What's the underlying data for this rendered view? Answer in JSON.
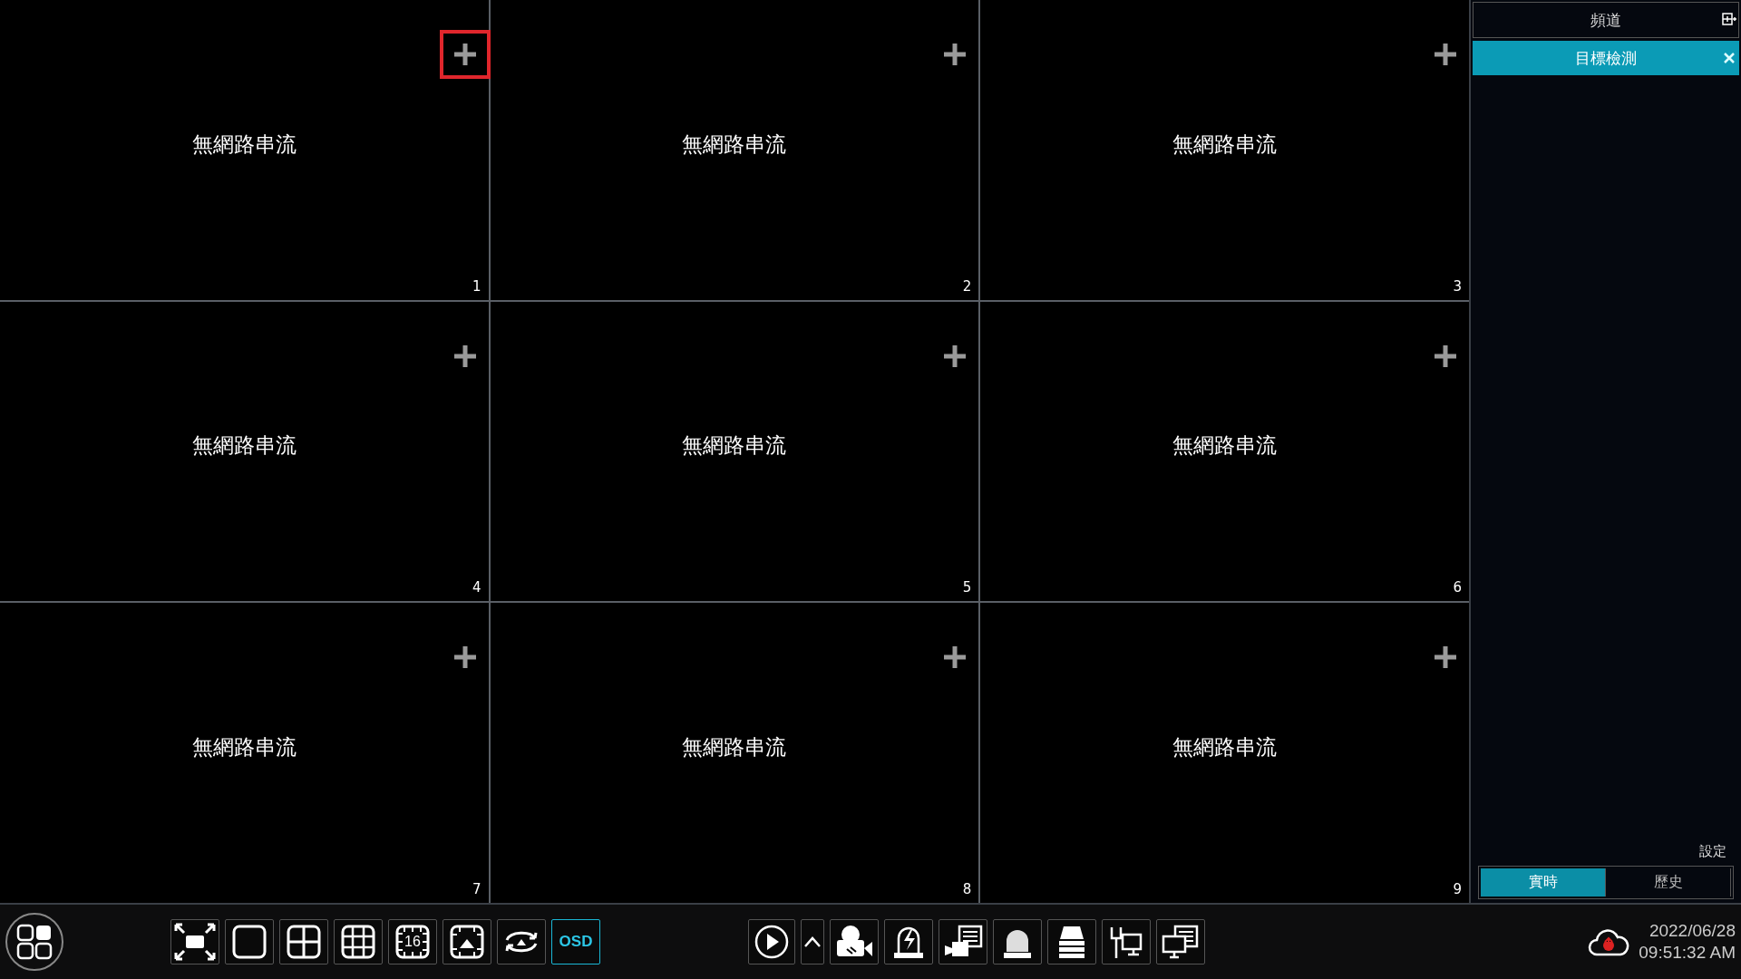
{
  "cells": [
    {
      "number": "1",
      "message": "無網路串流",
      "highlighted": true
    },
    {
      "number": "2",
      "message": "無網路串流",
      "highlighted": false
    },
    {
      "number": "3",
      "message": "無網路串流",
      "highlighted": false
    },
    {
      "number": "4",
      "message": "無網路串流",
      "highlighted": false
    },
    {
      "number": "5",
      "message": "無網路串流",
      "highlighted": false
    },
    {
      "number": "6",
      "message": "無網路串流",
      "highlighted": false
    },
    {
      "number": "7",
      "message": "無網路串流",
      "highlighted": false
    },
    {
      "number": "8",
      "message": "無網路串流",
      "highlighted": false
    },
    {
      "number": "9",
      "message": "無網路串流",
      "highlighted": false
    }
  ],
  "sidebar": {
    "title": "頻道",
    "open_tab": "目標檢測",
    "settings_link": "設定",
    "tabs": [
      {
        "label": "實時",
        "selected": true
      },
      {
        "label": "歷史",
        "selected": false
      }
    ]
  },
  "toolbar": {
    "left_buttons": [
      {
        "kind": "fullscreen",
        "selected": false
      },
      {
        "kind": "layout-1",
        "selected": false
      },
      {
        "kind": "layout-4",
        "selected": false
      },
      {
        "kind": "layout-9",
        "selected": false
      },
      {
        "kind": "layout-16",
        "label": "16",
        "selected": false
      },
      {
        "kind": "custom-layout",
        "selected": false
      },
      {
        "kind": "sequence",
        "selected": false
      },
      {
        "kind": "osd",
        "label": "OSD",
        "selected": true
      }
    ],
    "right_buttons": [
      {
        "kind": "play"
      },
      {
        "kind": "caret"
      },
      {
        "kind": "record"
      },
      {
        "kind": "alarm"
      },
      {
        "kind": "camera-list"
      },
      {
        "kind": "siren"
      },
      {
        "kind": "disk"
      },
      {
        "kind": "network"
      },
      {
        "kind": "remote-monitor"
      }
    ],
    "date": "2022/06/28",
    "time": "09:51:32 AM"
  }
}
